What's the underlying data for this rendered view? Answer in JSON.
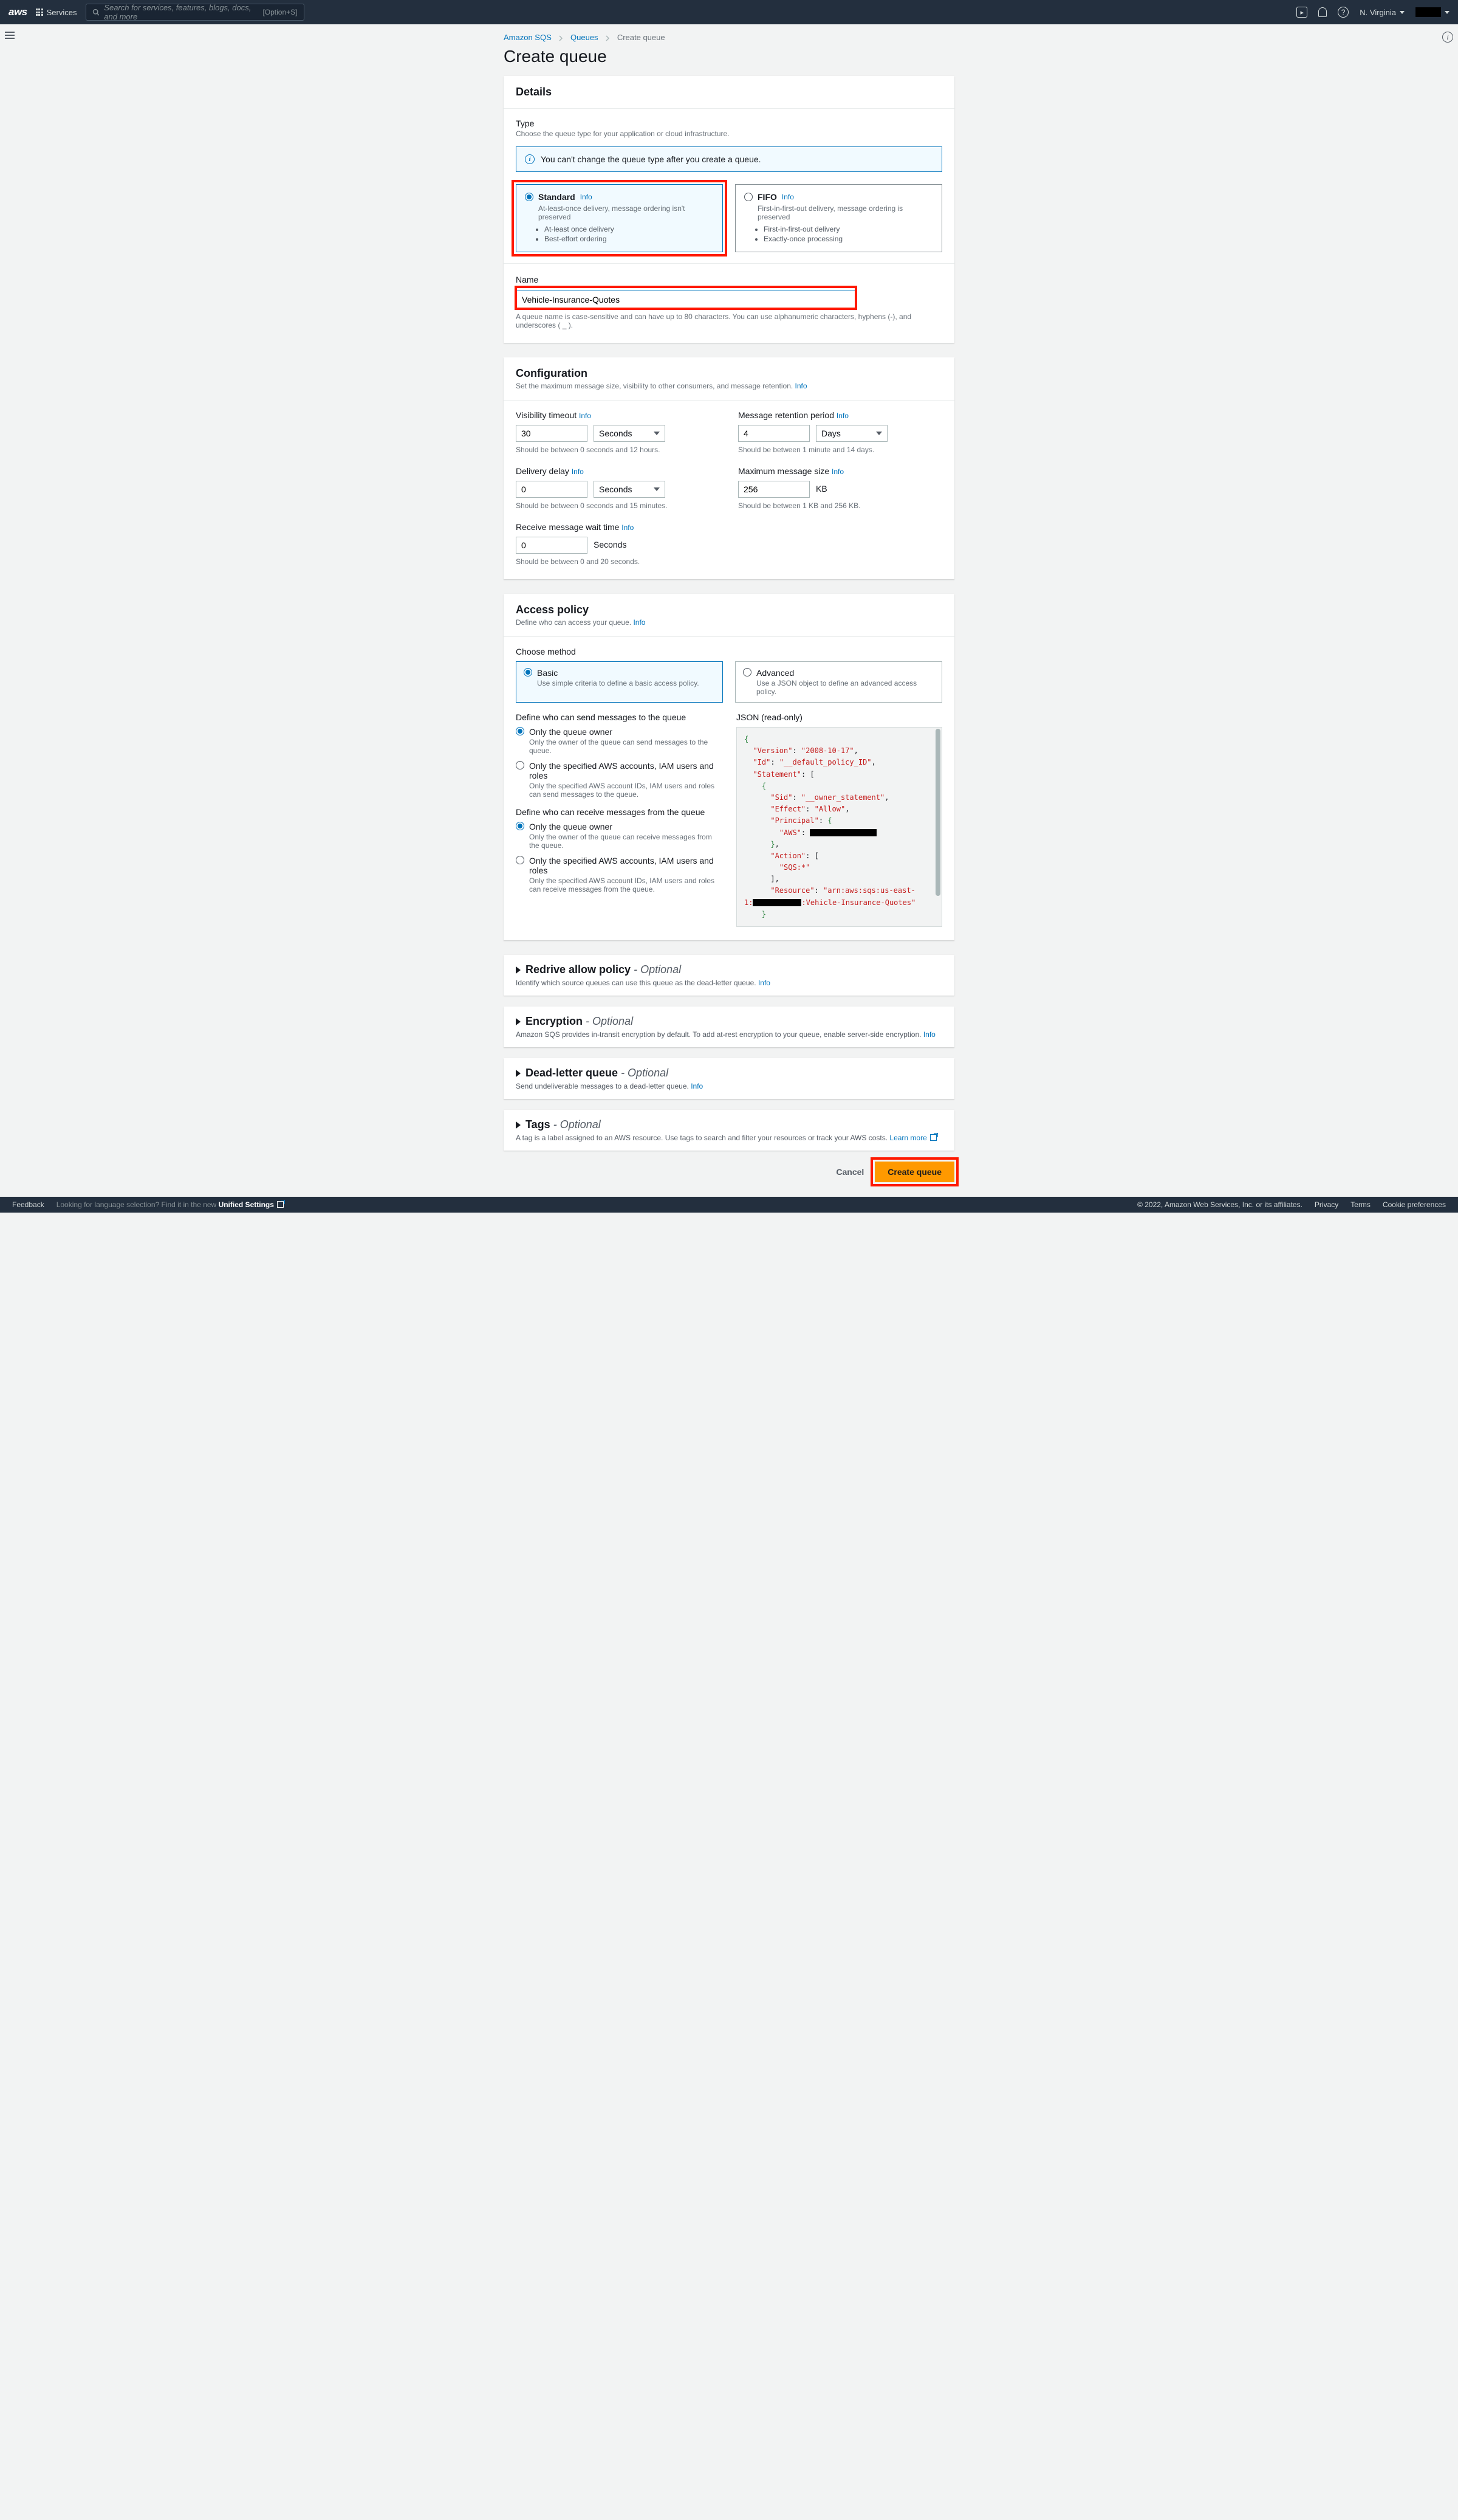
{
  "nav": {
    "logo": "aws",
    "services": "Services",
    "search_placeholder": "Search for services, features, blogs, docs, and more",
    "shortcut": "[Option+S]",
    "region": "N. Virginia"
  },
  "breadcrumbs": {
    "a": "Amazon SQS",
    "b": "Queues",
    "c": "Create queue"
  },
  "page_title": "Create queue",
  "details": {
    "heading": "Details",
    "type_label": "Type",
    "type_hint": "Choose the queue type for your application or cloud infrastructure.",
    "alert": "You can't change the queue type after you create a queue.",
    "standard": {
      "title": "Standard",
      "info": "Info",
      "desc": "At-least-once delivery, message ordering isn't preserved",
      "b1": "At-least once delivery",
      "b2": "Best-effort ordering"
    },
    "fifo": {
      "title": "FIFO",
      "info": "Info",
      "desc": "First-in-first-out delivery, message ordering is preserved",
      "b1": "First-in-first-out delivery",
      "b2": "Exactly-once processing"
    },
    "name_label": "Name",
    "name_value": "Vehicle-Insurance-Quotes",
    "name_hint": "A queue name is case-sensitive and can have up to 80 characters. You can use alphanumeric characters, hyphens (-), and underscores ( _ )."
  },
  "config": {
    "heading": "Configuration",
    "sub": "Set the maximum message size, visibility to other consumers, and message retention.",
    "info": "Info",
    "vis": {
      "label": "Visibility timeout",
      "info": "Info",
      "value": "30",
      "unit": "Seconds",
      "hint": "Should be between 0 seconds and 12 hours."
    },
    "ret": {
      "label": "Message retention period",
      "info": "Info",
      "value": "4",
      "unit": "Days",
      "hint": "Should be between 1 minute and 14 days."
    },
    "delay": {
      "label": "Delivery delay",
      "info": "Info",
      "value": "0",
      "unit": "Seconds",
      "hint": "Should be between 0 seconds and 15 minutes."
    },
    "max": {
      "label": "Maximum message size",
      "info": "Info",
      "value": "256",
      "unit": "KB",
      "hint": "Should be between 1 KB and 256 KB."
    },
    "wait": {
      "label": "Receive message wait time",
      "info": "Info",
      "value": "0",
      "unit": "Seconds",
      "hint": "Should be between 0 and 20 seconds."
    }
  },
  "access": {
    "heading": "Access policy",
    "sub": "Define who can access your queue.",
    "info": "Info",
    "choose": "Choose method",
    "basic": {
      "title": "Basic",
      "sub": "Use simple criteria to define a basic access policy."
    },
    "advanced": {
      "title": "Advanced",
      "sub": "Use a JSON object to define an advanced access policy."
    },
    "send_header": "Define who can send messages to the queue",
    "send_owner": {
      "label": "Only the queue owner",
      "sub": "Only the owner of the queue can send messages to the queue."
    },
    "send_spec": {
      "label": "Only the specified AWS accounts, IAM users and roles",
      "sub": "Only the specified AWS account IDs, IAM users and roles can send messages to the queue."
    },
    "recv_header": "Define who can receive messages from the queue",
    "recv_owner": {
      "label": "Only the queue owner",
      "sub": "Only the owner of the queue can receive messages from the queue."
    },
    "recv_spec": {
      "label": "Only the specified AWS accounts, IAM users and roles",
      "sub": "Only the specified AWS account IDs, IAM users and roles can receive messages from the queue."
    },
    "json_label": "JSON (read-only)",
    "json": {
      "version_k": "\"Version\"",
      "version_v": "\"2008-10-17\"",
      "id_k": "\"Id\"",
      "id_v": "\"__default_policy_ID\"",
      "stmt_k": "\"Statement\"",
      "sid_k": "\"Sid\"",
      "sid_v": "\"__owner_statement\"",
      "effect_k": "\"Effect\"",
      "effect_v": "\"Allow\"",
      "principal_k": "\"Principal\"",
      "aws_k": "\"AWS\"",
      "action_k": "\"Action\"",
      "action_v": "\"SQS:*\"",
      "resource_k": "\"Resource\"",
      "resource_v1": "\"arn:aws:sqs:us-east-",
      "resource_v2": "1:",
      "resource_v3": ":Vehicle-Insurance-Quotes\""
    }
  },
  "redrive": {
    "title": "Redrive allow policy",
    "opt": "- Optional",
    "sub": "Identify which source queues can use this queue as the dead-letter queue.",
    "info": "Info"
  },
  "encryption": {
    "title": "Encryption",
    "opt": "- Optional",
    "sub": "Amazon SQS provides in-transit encryption by default. To add at-rest encryption to your queue, enable server-side encryption.",
    "info": "Info"
  },
  "dlq": {
    "title": "Dead-letter queue",
    "opt": "- Optional",
    "sub": "Send undeliverable messages to a dead-letter queue.",
    "info": "Info"
  },
  "tags": {
    "title": "Tags",
    "opt": "- Optional",
    "sub": "A tag is a label assigned to an AWS resource. Use tags to search and filter your resources or track your AWS costs.",
    "learn": "Learn more"
  },
  "actions": {
    "cancel": "Cancel",
    "create": "Create queue"
  },
  "footer": {
    "feedback": "Feedback",
    "lang": "Looking for language selection? Find it in the new",
    "unified": "Unified Settings",
    "copyright": "© 2022, Amazon Web Services, Inc. or its affiliates.",
    "privacy": "Privacy",
    "terms": "Terms",
    "cookie": "Cookie preferences"
  }
}
